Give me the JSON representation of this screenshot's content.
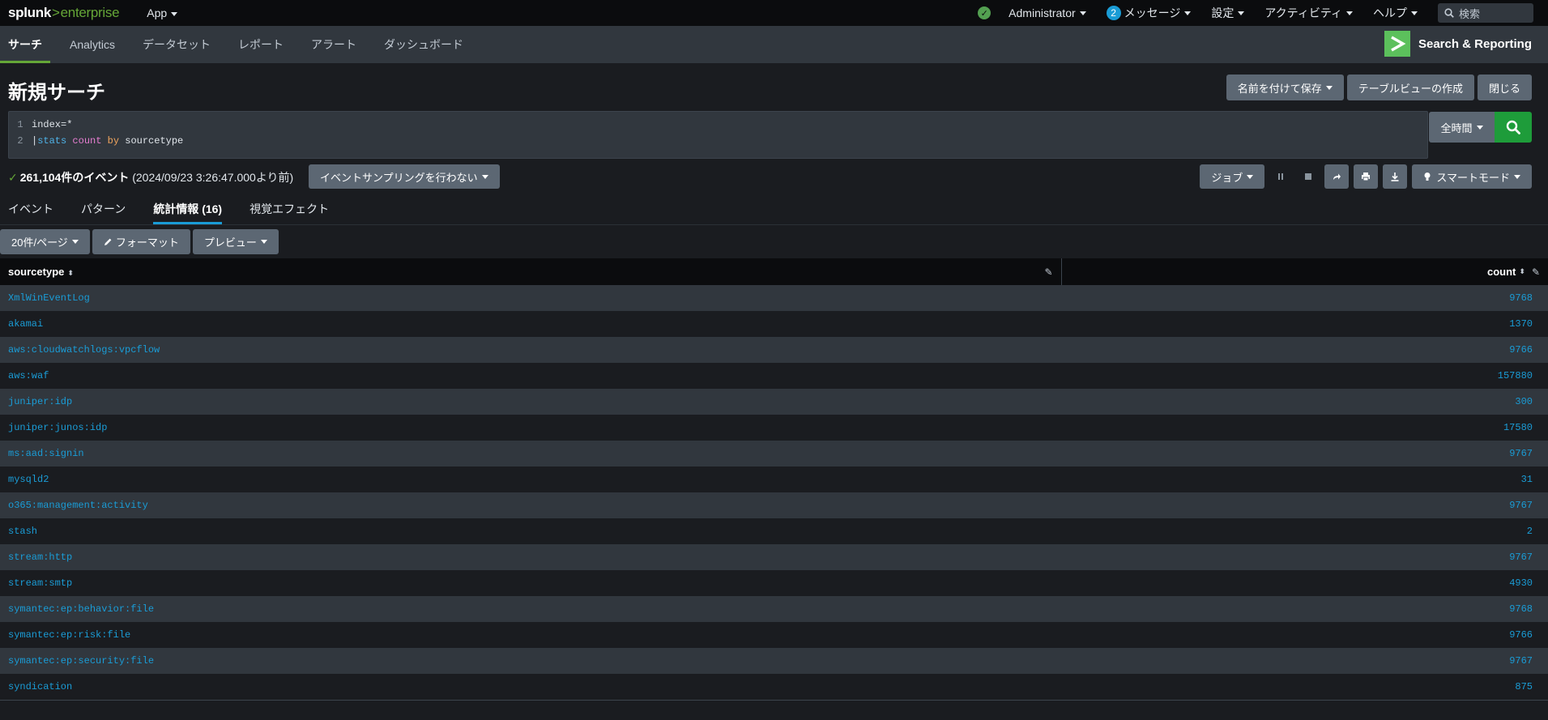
{
  "topbar": {
    "logo_splunk": "splunk",
    "logo_gt": ">",
    "logo_enterprise": "enterprise",
    "app_menu": "App",
    "user": "Administrator",
    "message_count": "2",
    "messages": "メッセージ",
    "settings": "設定",
    "activity": "アクティビティ",
    "help": "ヘルプ",
    "search_placeholder": "検索"
  },
  "appnav": {
    "tabs": [
      {
        "label": "サーチ"
      },
      {
        "label": "Analytics"
      },
      {
        "label": "データセット"
      },
      {
        "label": "レポート"
      },
      {
        "label": "アラート"
      },
      {
        "label": "ダッシュボード"
      }
    ],
    "app_name": "Search & Reporting"
  },
  "page": {
    "title": "新規サーチ",
    "save_as": "名前を付けて保存",
    "create_table_view": "テーブルビューの作成",
    "close": "閉じる"
  },
  "search": {
    "line1_num": "1",
    "line1": "index=*",
    "line2_num": "2",
    "line2_pipe": "|",
    "line2_cmd": "stats",
    "line2_fn": "count",
    "line2_kw": "by",
    "line2_field": "sourcetype",
    "time_range": "全時間"
  },
  "status": {
    "events": "261,104件のイベント",
    "time_note": "(2024/09/23 3:26:47.000より前)",
    "sampling": "イベントサンプリングを行わない",
    "job": "ジョブ",
    "mode": "スマートモード"
  },
  "results_tabs": [
    {
      "label": "イベント"
    },
    {
      "label": "パターン"
    },
    {
      "label": "統計情報 (16)"
    },
    {
      "label": "視覚エフェクト"
    }
  ],
  "toolbar": {
    "per_page": "20件/ページ",
    "format": "フォーマット",
    "preview": "プレビュー"
  },
  "table": {
    "columns": [
      "sourcetype",
      "count"
    ],
    "rows": [
      {
        "sourcetype": "XmlWinEventLog",
        "count": "9768"
      },
      {
        "sourcetype": "akamai",
        "count": "1370"
      },
      {
        "sourcetype": "aws:cloudwatchlogs:vpcflow",
        "count": "9766"
      },
      {
        "sourcetype": "aws:waf",
        "count": "157880"
      },
      {
        "sourcetype": "juniper:idp",
        "count": "300"
      },
      {
        "sourcetype": "juniper:junos:idp",
        "count": "17580"
      },
      {
        "sourcetype": "ms:aad:signin",
        "count": "9767"
      },
      {
        "sourcetype": "mysqld2",
        "count": "31"
      },
      {
        "sourcetype": "o365:management:activity",
        "count": "9767"
      },
      {
        "sourcetype": "stash",
        "count": "2"
      },
      {
        "sourcetype": "stream:http",
        "count": "9767"
      },
      {
        "sourcetype": "stream:smtp",
        "count": "4930"
      },
      {
        "sourcetype": "symantec:ep:behavior:file",
        "count": "9768"
      },
      {
        "sourcetype": "symantec:ep:risk:file",
        "count": "9766"
      },
      {
        "sourcetype": "symantec:ep:security:file",
        "count": "9767"
      },
      {
        "sourcetype": "syndication",
        "count": "875"
      }
    ]
  },
  "colors": {
    "brand_green": "#65a637",
    "link_blue": "#1a9cd6",
    "search_button": "#1e9c3a"
  },
  "icons": [
    "check-circle-icon",
    "search-icon",
    "caret-down-icon",
    "pause-icon",
    "stop-icon",
    "share-icon",
    "print-icon",
    "download-icon",
    "lightbulb-icon",
    "pencil-icon",
    "sort-icon",
    "app-logo-icon"
  ]
}
